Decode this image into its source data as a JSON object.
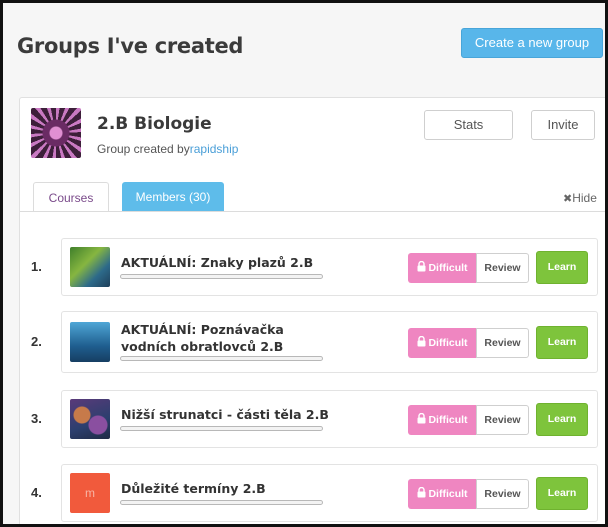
{
  "header": {
    "title": "Groups I've created",
    "create_button": "Create a new group"
  },
  "group": {
    "name": "2.B Biologie",
    "created_prefix": "Group created by",
    "created_by": "rapidship",
    "stats_button": "Stats",
    "invite_button": "Invite",
    "tabs": [
      {
        "label": "Courses",
        "active": true
      },
      {
        "label": "Members (30)",
        "active": false
      }
    ],
    "hide_label": "Hide"
  },
  "courses": [
    {
      "number": "1.",
      "title": "AKTUÁLNÍ: Znaky plazů 2.B",
      "thumb": "chameleon",
      "progress": 0
    },
    {
      "number": "2.",
      "title": "AKTUÁLNÍ: Poznávačka vodních obratlovců 2.B",
      "thumb": "shark",
      "progress": 0
    },
    {
      "number": "3.",
      "title": "Nižší strunatci - části těla 2.B",
      "thumb": "coral",
      "progress": 0
    },
    {
      "number": "4.",
      "title": "Důležité termíny 2.B",
      "thumb": "m",
      "thumb_letter": "m",
      "progress": 0
    }
  ],
  "course_actions": {
    "difficult": "Difficult",
    "review": "Review",
    "learn": "Learn"
  },
  "colors": {
    "accent_blue": "#58b6ea",
    "difficult_pink": "#ef86c1",
    "learn_green": "#7ec43c"
  }
}
